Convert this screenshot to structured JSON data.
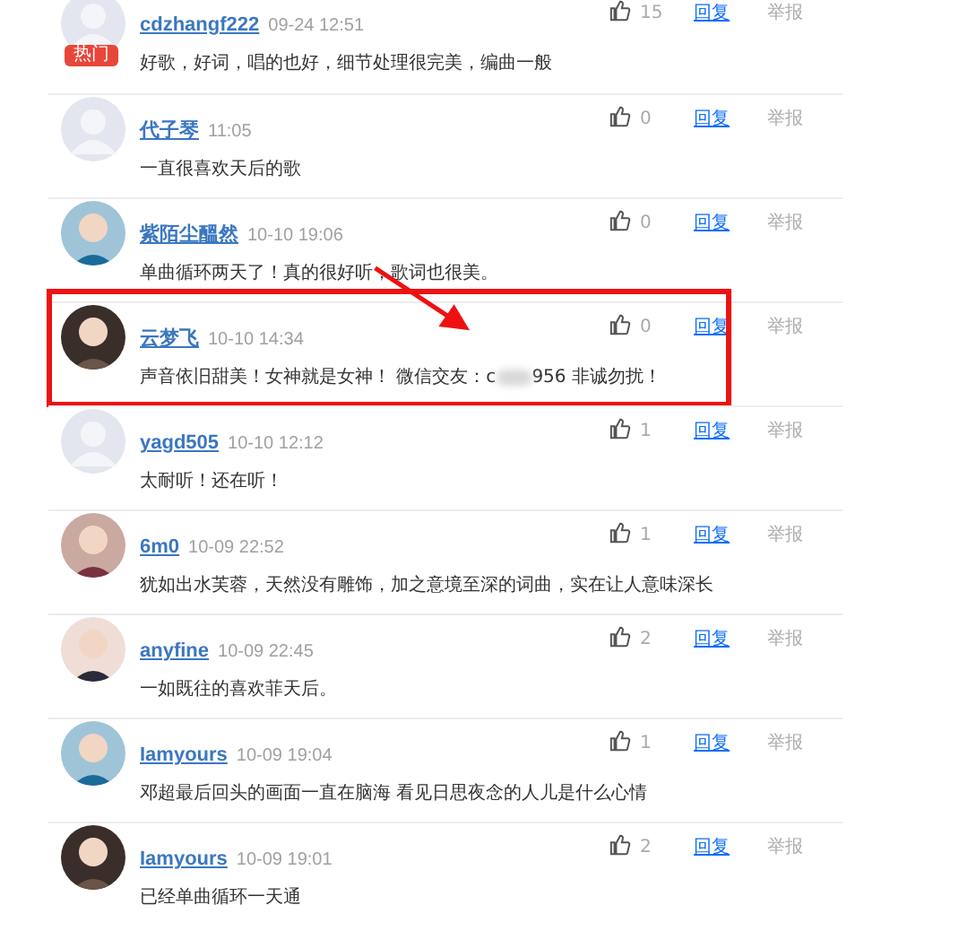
{
  "comments": [
    {
      "user": "cdzhangf222",
      "time": "09-24 12:51",
      "text": "好歌，好词，唱的也好，细节处理很完美，编曲一般",
      "likes": "15",
      "reply": "回复",
      "report": "举报",
      "avatar": {
        "kind": "photo_blank",
        "badge": "热门"
      },
      "highlighted": false
    },
    {
      "user": "代子琴",
      "time": "11:05",
      "text": "一直很喜欢天后的歌",
      "likes": "0",
      "reply": "回复",
      "report": "举报",
      "avatar": {
        "kind": "default"
      },
      "highlighted": false
    },
    {
      "user": "紫陌尘醞然",
      "time": "10-10 19:06",
      "text": "单曲循环两天了！真的很好听，歌词也很美。",
      "likes": "0",
      "reply": "回复",
      "report": "举报",
      "highlighted": false
    },
    {
      "user": "云梦飞",
      "time": "10-10 14:34",
      "text": "声音依旧甜美！女神就是女神！ 微信交友：c",
      "blurred": true,
      "text_after_blur": "956 非诚勿扰！",
      "likes": "0",
      "reply": "回复",
      "report": "举报",
      "highlighted": true
    },
    {
      "user": "yagd505",
      "time": "10-10 12:12",
      "text": "太耐听！还在听！",
      "likes": "1",
      "reply": "回复",
      "report": "举报",
      "avatar": {
        "kind": "default"
      },
      "highlighted": false
    },
    {
      "user": "6m0",
      "time": "10-09 22:52",
      "text": "犹如出水芙蓉，天然没有雕饰，加之意境至深的词曲，实在让人意味深长",
      "likes": "1",
      "reply": "回复",
      "report": "举报",
      "highlighted": false
    },
    {
      "user": "anyfine",
      "time": "10-09 22:45",
      "text": "一如既往的喜欢菲天后。",
      "likes": "2",
      "reply": "回复",
      "report": "举报",
      "highlighted": false
    },
    {
      "user": "Iamyours",
      "time": "10-09 19:04",
      "text": "邓超最后回头的画面一直在脑海 看见日思夜念的人儿是什么心情",
      "likes": "1",
      "reply": "回复",
      "report": "举报",
      "highlighted": false
    },
    {
      "user": "Iamyours",
      "time": "10-09 19:01",
      "text": "已经单曲循环一天通",
      "likes": "2",
      "reply": "回复",
      "report": "举报",
      "highlighted": false
    }
  ],
  "annotation": {
    "arrow": true
  }
}
